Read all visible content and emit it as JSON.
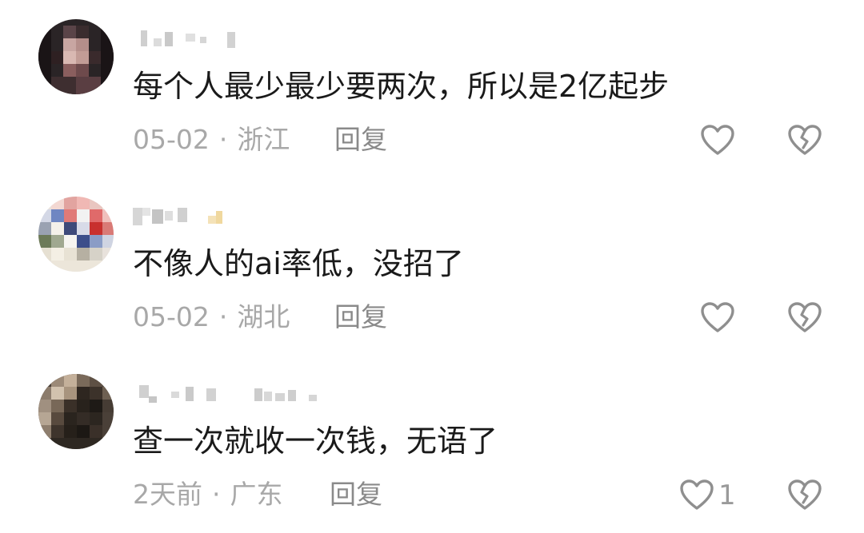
{
  "comments": [
    {
      "text": "每个人最少最少要两次，所以是2亿起步",
      "date": "05-02",
      "separator": "·",
      "location": "浙江",
      "reply_label": "回复",
      "like_count": ""
    },
    {
      "text": "不像人的ai率低，没招了",
      "date": "05-02",
      "separator": "·",
      "location": "湖北",
      "reply_label": "回复",
      "like_count": ""
    },
    {
      "text": "查一次就收一次钱，无语了",
      "date": "2天前",
      "separator": "·",
      "location": "广东",
      "reply_label": "回复",
      "like_count": "1"
    }
  ],
  "icons": {
    "like": "heart-outline-icon",
    "dislike": "broken-heart-icon"
  },
  "colors": {
    "text": "#1a1a1a",
    "meta": "#a8a8a8",
    "icon": "#8f8f8f"
  }
}
